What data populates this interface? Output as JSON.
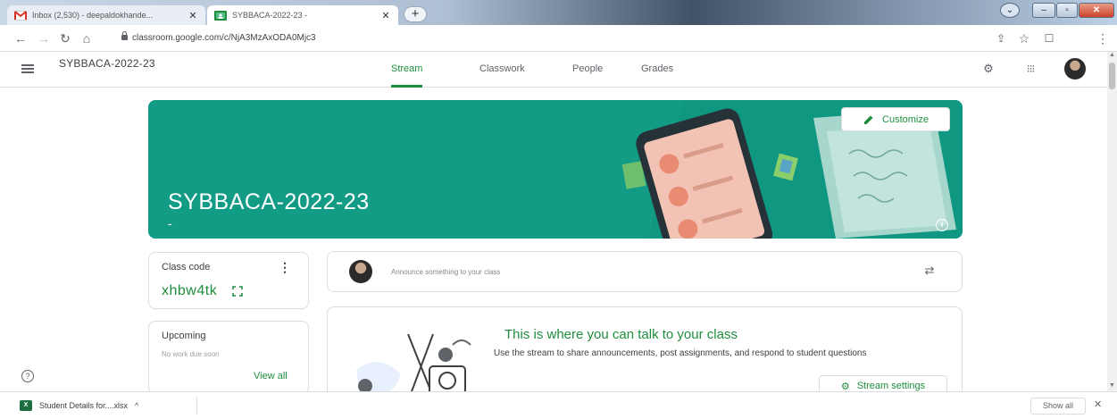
{
  "browser": {
    "tabs": [
      {
        "title": "Inbox (2,530) - deepaldokhande...",
        "favicon": "gmail-icon",
        "active": false
      },
      {
        "title": "SYBBACA-2022-23 -",
        "favicon": "classroom-icon",
        "active": true
      }
    ],
    "new_tab": "+",
    "url": "classroom.google.com/c/NjA3MzAxODA0Mjc3"
  },
  "classroom": {
    "class_name": "SYBBACA-2022-23",
    "tabs": [
      {
        "label": "Stream",
        "active": true
      },
      {
        "label": "Classwork",
        "active": false
      },
      {
        "label": "People",
        "active": false
      },
      {
        "label": "Grades",
        "active": false
      }
    ],
    "accent_color": "#1e8e3e",
    "banner_color": "#129b85"
  },
  "banner": {
    "title": "SYBBACA-2022-23",
    "subtitle": "-",
    "customize_label": "Customize"
  },
  "class_code": {
    "label": "Class code",
    "code": "xhbw4tk"
  },
  "upcoming": {
    "label": "Upcoming",
    "empty_text": "No work due soon",
    "view_all": "View all"
  },
  "announce": {
    "placeholder": "Announce something to your class"
  },
  "stream_empty": {
    "title": "This is where you can talk to your class",
    "body": "Use the stream to share announcements, post assignments, and respond to student questions",
    "settings_button": "Stream settings"
  },
  "downloads": {
    "file_name": "Student Details for....xlsx",
    "show_all": "Show all"
  }
}
